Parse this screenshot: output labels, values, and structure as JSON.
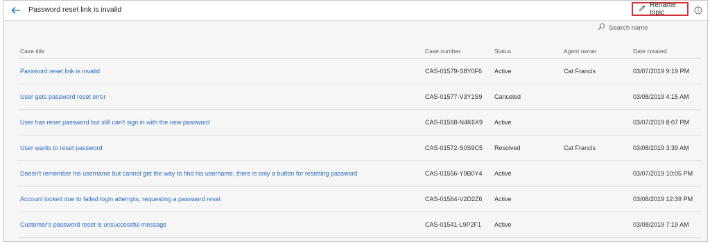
{
  "header": {
    "title": "Password reset link is invalid",
    "rename_label": "Rename topic"
  },
  "search": {
    "placeholder": "Search name"
  },
  "columns": {
    "case_title": "Case title",
    "case_number": "Case number",
    "status": "Status",
    "agent_owner": "Agent owner",
    "date_created": "Date created"
  },
  "rows": [
    {
      "title": "Password reset link is invalid",
      "number": "CAS-01579-S8Y0F6",
      "status": "Active",
      "agent": "Cat Francis",
      "date": "03/07/2019 9:19 PM"
    },
    {
      "title": "User gets password reset error",
      "number": "CAS-01577-V3Y1S9",
      "status": "Canceled",
      "agent": "",
      "date": "03/08/2019 4:15 AM"
    },
    {
      "title": "User has reset password but still can't sign in with the new password",
      "number": "CAS-01568-N4K6X9",
      "status": "Active",
      "agent": "",
      "date": "03/07/2019 8:07 PM"
    },
    {
      "title": "User wants to reset password",
      "number": "CAS-01572-S0S9C5",
      "status": "Resolved",
      "agent": "Cat Francis",
      "date": "03/08/2019 3:39 AM"
    },
    {
      "title": "Doesn't remember his username but cannot get the way to find his username, there is only a button for resetting password",
      "number": "CAS-01556-Y9B0Y4",
      "status": "Active",
      "agent": "",
      "date": "03/07/2019 10:05 PM"
    },
    {
      "title": "Account locked due to failed login attempts, requesting a password reset",
      "number": "CAS-01564-V2D2Z6",
      "status": "Active",
      "agent": "",
      "date": "03/08/2019 12:39 PM"
    },
    {
      "title": "Customer's password reset is unsuccessful message",
      "number": "CAS-01541-L9P2F1",
      "status": "Active",
      "agent": "",
      "date": "03/08/2019 7:19 AM"
    }
  ]
}
